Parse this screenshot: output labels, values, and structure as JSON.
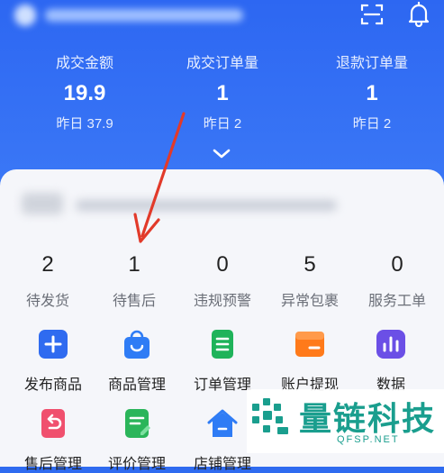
{
  "header": {
    "icons": [
      "scan-icon",
      "bell-icon"
    ]
  },
  "stats": [
    {
      "label": "成交金额",
      "value": "19.9",
      "yesterday": "昨日 37.9"
    },
    {
      "label": "成交订单量",
      "value": "1",
      "yesterday": "昨日 2"
    },
    {
      "label": "退款订单量",
      "value": "1",
      "yesterday": "昨日 2"
    }
  ],
  "orders": [
    {
      "count": "2",
      "label": "待发货"
    },
    {
      "count": "1",
      "label": "待售后"
    },
    {
      "count": "0",
      "label": "违规预警"
    },
    {
      "count": "5",
      "label": "异常包裹"
    },
    {
      "count": "0",
      "label": "服务工单"
    }
  ],
  "tools": [
    {
      "label": "发布商品",
      "icon": "plus-icon",
      "color": "#2f6bf0"
    },
    {
      "label": "商品管理",
      "icon": "bag-icon",
      "color": "#2f7cf5"
    },
    {
      "label": "订单管理",
      "icon": "order-icon",
      "color": "#1fb35a"
    },
    {
      "label": "账户提现",
      "icon": "wallet-icon",
      "color": "#ff7a1a"
    },
    {
      "label": "数据",
      "icon": "chart-icon",
      "color": "#6b4fe6"
    },
    {
      "label": "售后管理",
      "icon": "return-icon",
      "color": "#f0506e"
    },
    {
      "label": "评价管理",
      "icon": "review-icon",
      "color": "#2bb55a"
    },
    {
      "label": "店铺管理",
      "icon": "shop-icon",
      "color": "#2f7cf5"
    }
  ],
  "watermark": {
    "brand": "量链科技",
    "domain": "QFSP.NET",
    "color": "#1a9e8e"
  }
}
